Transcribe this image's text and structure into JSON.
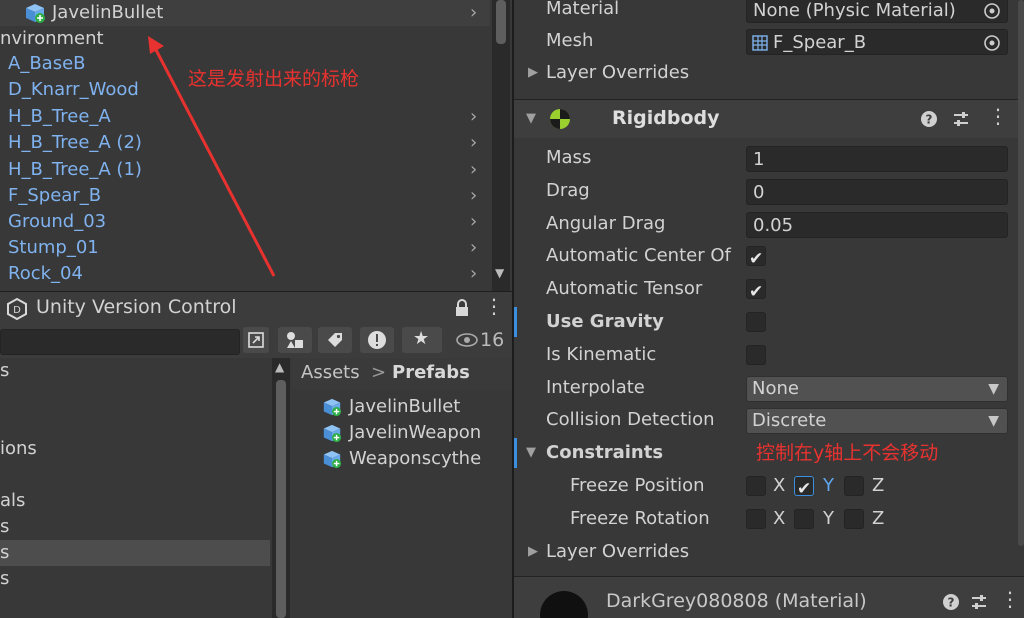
{
  "hierarchy": {
    "top_item": "JavelinBullet",
    "group": "nvironment",
    "items": [
      "A_BaseB",
      "D_Knarr_Wood",
      "H_B_Tree_A",
      "H_B_Tree_A (2)",
      "H_B_Tree_A (1)",
      "F_Spear_B",
      "Ground_03",
      "Stump_01",
      "Rock_04"
    ],
    "annotation": "这是发射出来的标枪"
  },
  "version_control": {
    "title": "Unity Version Control"
  },
  "project": {
    "hidden_count": "16",
    "breadcrumb_root": "Assets",
    "breadcrumb_sep": ">",
    "breadcrumb_current": "Prefabs",
    "left_items": [
      "s",
      "",
      "",
      "ions",
      "",
      "als",
      "s",
      "s",
      "s"
    ],
    "assets": [
      "JavelinBullet",
      "JavelinWeapon",
      "Weaponscythe"
    ]
  },
  "inspector": {
    "material_label": "Material",
    "material_value": "None (Physic Material)",
    "mesh_label": "Mesh",
    "mesh_value": "F_Spear_B",
    "layer_overrides_1": "Layer Overrides",
    "rigidbody": {
      "title": "Rigidbody",
      "mass_label": "Mass",
      "mass": "1",
      "drag_label": "Drag",
      "drag": "0",
      "angular_drag_label": "Angular Drag",
      "angular_drag": "0.05",
      "auto_center_label": "Automatic Center Of",
      "auto_center": true,
      "auto_tensor_label": "Automatic Tensor",
      "auto_tensor": true,
      "use_gravity_label": "Use Gravity",
      "use_gravity": false,
      "is_kinematic_label": "Is Kinematic",
      "is_kinematic": false,
      "interpolate_label": "Interpolate",
      "interpolate": "None",
      "collision_label": "Collision Detection",
      "collision": "Discrete",
      "constraints_label": "Constraints",
      "freeze_position_label": "Freeze Position",
      "freeze_rotation_label": "Freeze Rotation",
      "axis_x": "X",
      "axis_y": "Y",
      "axis_z": "Z",
      "freeze_position": {
        "x": false,
        "y": true,
        "z": false
      },
      "freeze_rotation": {
        "x": false,
        "y": false,
        "z": false
      },
      "annotation": "控制在y轴上不会移动",
      "layer_overrides": "Layer Overrides"
    },
    "material_component": "DarkGrey080808 (Material)"
  },
  "colors": {
    "prefab_text": "#7fb2ee",
    "annotation": "#e8322f",
    "selection_blue": "#3b8fdc"
  }
}
